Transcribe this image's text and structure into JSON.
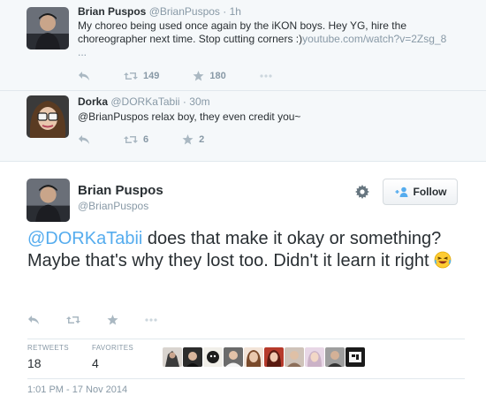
{
  "thread": {
    "tweet1": {
      "name": "Brian Puspos",
      "handle": "@BrianPuspos",
      "dot": "·",
      "time": "1h",
      "text": "My choreo being used once again by the iKON boys. Hey YG, hire the choreographer next time. Stop cutting corners :)",
      "url": "youtube.com/watch?v=2Zsg_8",
      "ellipsis": "...",
      "retweets": "149",
      "favorites": "180"
    },
    "tweet2": {
      "name": "Dorka",
      "handle": "@DORKaTabii",
      "dot": "·",
      "time": "30m",
      "text": "@BrianPuspos relax boy, they even credit you~",
      "retweets": "6",
      "favorites": "2"
    }
  },
  "main": {
    "name": "Brian Puspos",
    "handle": "@BrianPuspos",
    "follow_label": "Follow",
    "mention": "@DORKaTabii",
    "text_rest": " does that make it okay or something? Maybe that's why they lost too. Didn't it learn it right",
    "stats": {
      "retweets_label": "RETWEETS",
      "retweets": "18",
      "favorites_label": "FAVORITES",
      "favorites": "4"
    },
    "timestamp": "1:01 PM - 17 Nov 2014"
  },
  "colors": {
    "accent": "#55acee",
    "muted": "#8899a6",
    "text": "#292f33",
    "thread_bg": "#f5f8fa"
  },
  "icons": [
    "reply-icon",
    "retweet-icon",
    "favorite-icon",
    "more-icon",
    "gear-icon",
    "follow-user-icon",
    "laughing-emoji-icon"
  ]
}
